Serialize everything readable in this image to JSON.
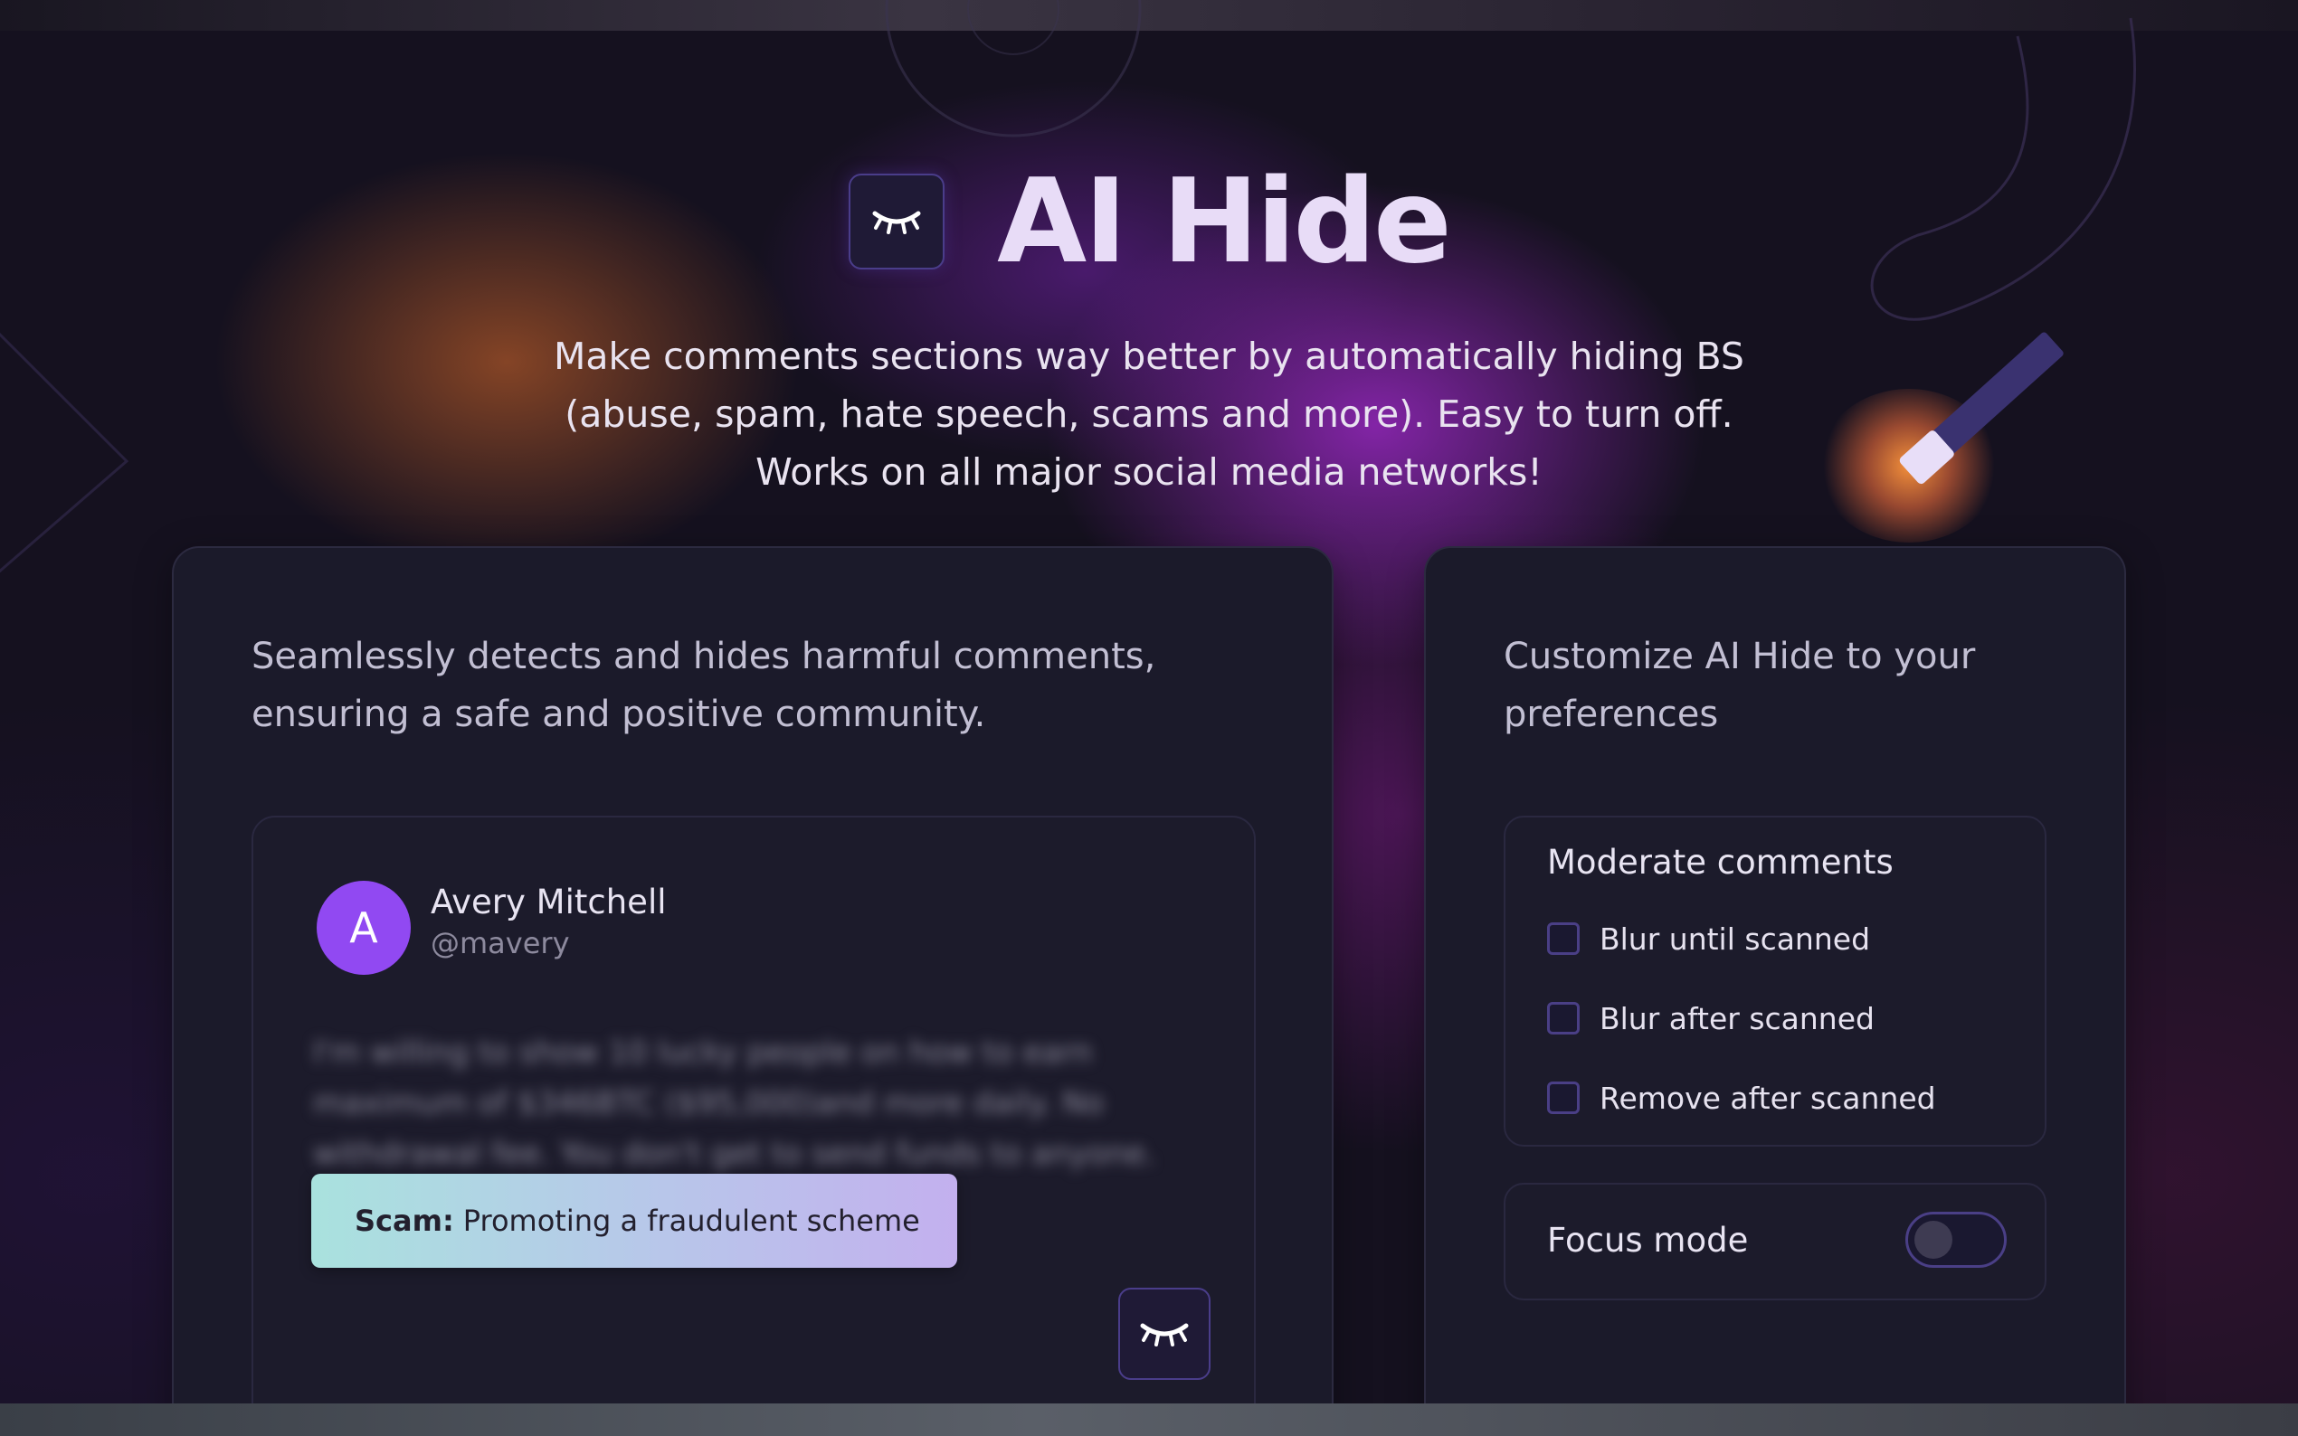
{
  "hero": {
    "title": "AI Hide",
    "subtitle_lines": [
      "Make comments sections way better by automatically hiding BS",
      "(abuse, spam, hate speech, scams and more). Easy to turn off.",
      "Works on all major social media networks!"
    ],
    "logo_icon": "closed-eye-icon"
  },
  "left_card": {
    "heading": "Seamlessly detects and hides harmful comments, ensuring a safe and positive community.",
    "comment": {
      "avatar_letter": "A",
      "author_name": "Avery Mitchell",
      "author_handle": "@mavery",
      "blurred_text": "I'm willing to show 10 lucky people on how to earn maximum of $346BTC ($95,000)and more daily. No withdrawal fee. You don't get to send funds to anyone.",
      "flag": {
        "label": "Scam:",
        "reason": "Promoting a fraudulent scheme"
      },
      "toggle_icon": "closed-eye-icon"
    }
  },
  "right_card": {
    "heading": "Customize AI Hide to your preferences",
    "moderate": {
      "title": "Moderate comments",
      "options": [
        {
          "label": "Blur until scanned",
          "checked": false
        },
        {
          "label": "Blur after scanned",
          "checked": false
        },
        {
          "label": "Remove after scanned",
          "checked": false
        }
      ]
    },
    "focus": {
      "label": "Focus mode",
      "enabled": false
    }
  },
  "colors": {
    "accent": "#9149f2",
    "card_bg": "#1b1a2a",
    "title": "#e8dcf7"
  }
}
